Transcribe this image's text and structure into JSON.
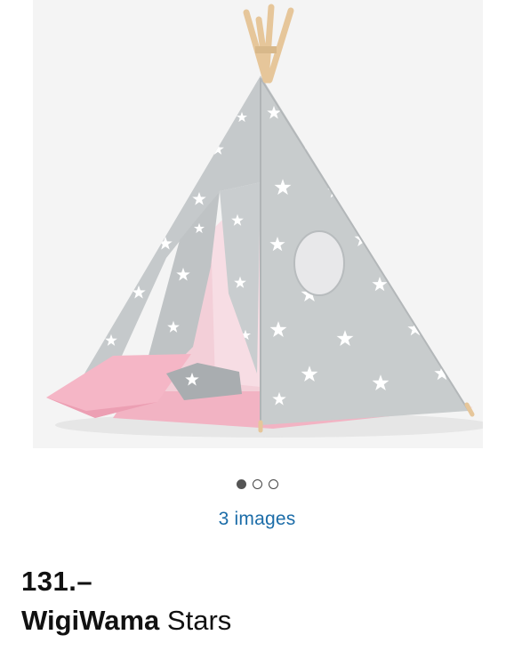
{
  "gallery": {
    "image_alt": "Teepee tent grey with white stars",
    "image_count_label": "3 images",
    "dots": [
      {
        "active": true
      },
      {
        "active": false
      },
      {
        "active": false
      }
    ]
  },
  "product": {
    "price": "131.–",
    "brand": "WigiWama",
    "name": " Stars"
  },
  "colors": {
    "link": "#1b6ca8",
    "tent_grey": "#c3c7c9",
    "pink": "#f4b8c6"
  }
}
